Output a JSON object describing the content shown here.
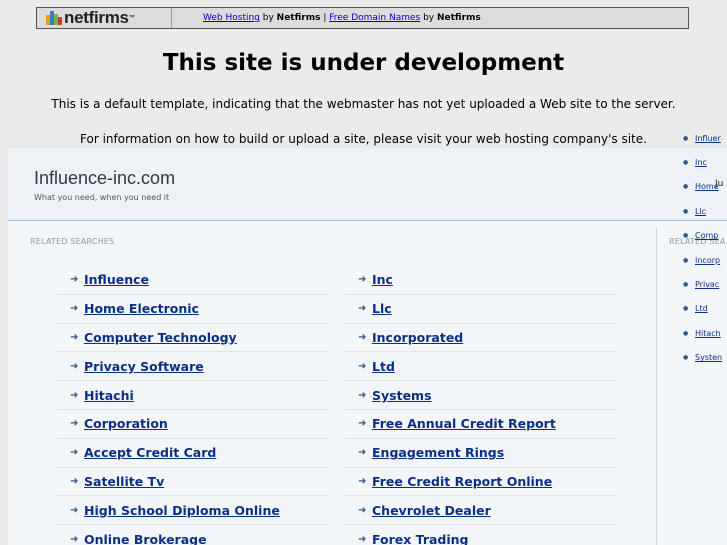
{
  "topbar": {
    "logo_text": "netfirms",
    "logo_tm": "™",
    "link1": "Web Hosting",
    "by1": " by ",
    "brand1": "Netfirms",
    "sep": " | ",
    "link2": "Free Domain Names",
    "by2": " by ",
    "brand2": "Netfirms"
  },
  "heading": "This site is under development",
  "message1": "This is a default template, indicating that the webmaster has not yet uploaded a Web site to the server.",
  "message2": "For information on how to build or upload a site, please visit your web hosting company's site.",
  "parked": {
    "domain": "Influence-inc.com",
    "tagline": "What you need, when you need it",
    "header_right_partial": "Ju",
    "related_title": "RELATED SEARCHES",
    "related_title_right_partial": "RELATED SEA",
    "col1": [
      "Influence",
      "Home Electronic",
      "Computer Technology",
      "Privacy Software",
      "Hitachi",
      "Corporation",
      "Accept Credit Card",
      "Satellite Tv",
      "High School Diploma Online",
      "Online Brokerage"
    ],
    "col2": [
      "Inc",
      "Llc",
      "Incorporated",
      "Ltd",
      "Systems",
      "Free Annual Credit Report",
      "Engagement Rings",
      "Free Credit Report Online",
      "Chevrolet Dealer",
      "Forex Trading"
    ],
    "sidebar_items": [
      "Influer",
      "Inc",
      "Home",
      "Llc",
      "Comp",
      "Incorp",
      "Privac",
      "Ltd",
      "Hitach",
      "Systen"
    ]
  }
}
